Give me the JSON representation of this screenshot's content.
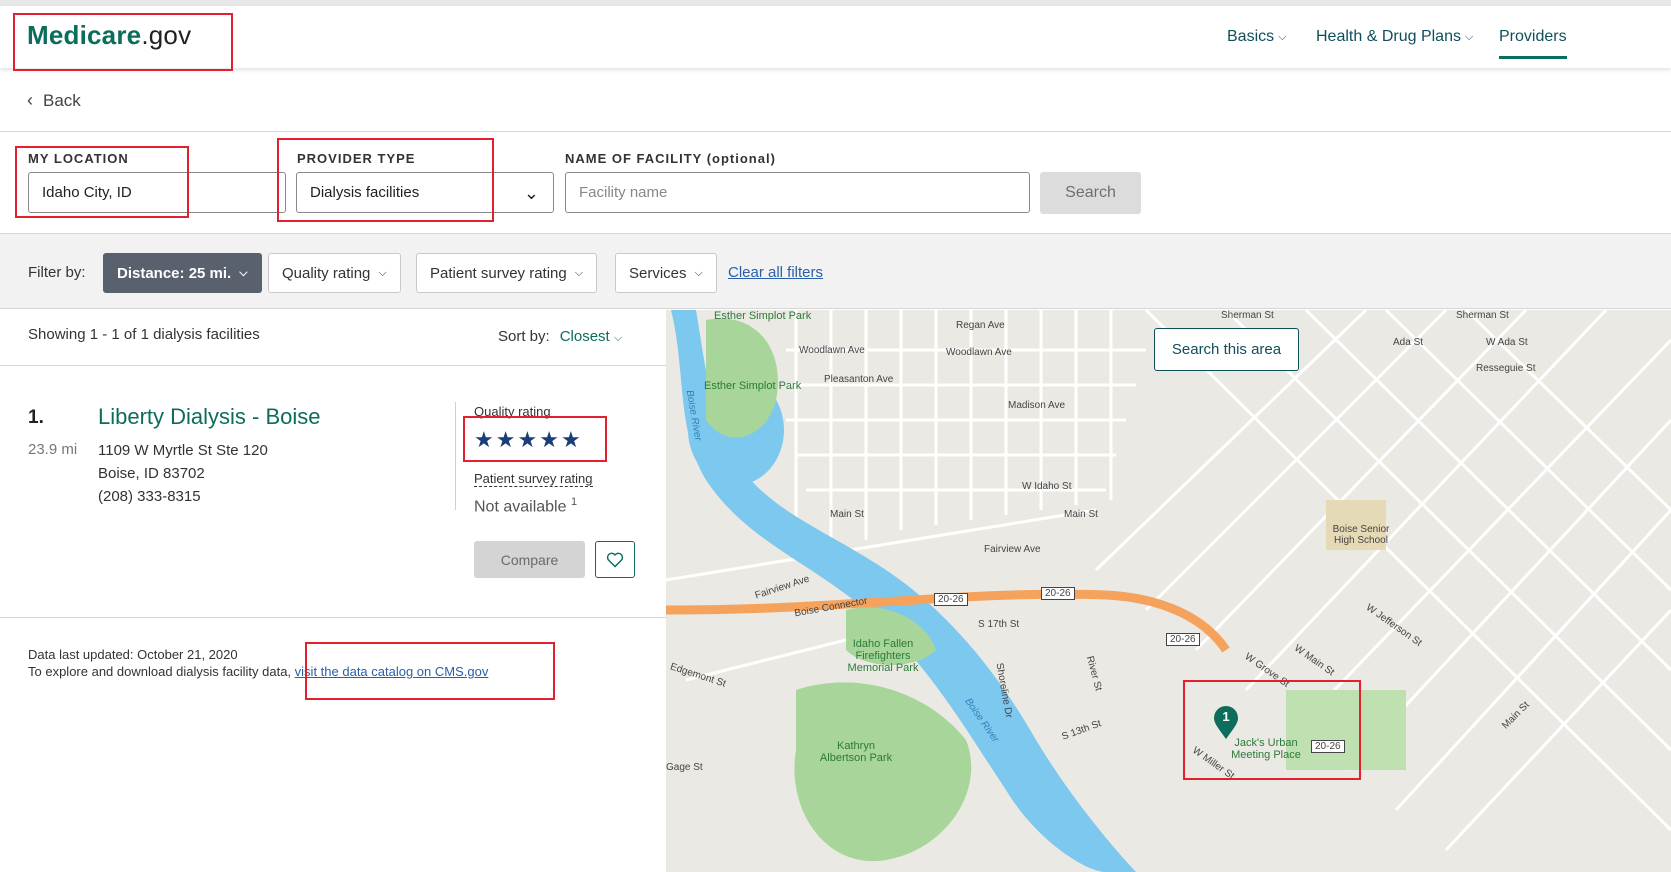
{
  "header": {
    "logo_main": "Medicare",
    "logo_suffix": ".gov",
    "nav": [
      {
        "label": "Basics"
      },
      {
        "label": "Health & Drug Plans"
      },
      {
        "label": "Providers"
      }
    ]
  },
  "back_label": "Back",
  "search": {
    "location_label": "MY LOCATION",
    "location_value": "Idaho City, ID",
    "provider_type_label": "PROVIDER TYPE",
    "provider_type_value": "Dialysis facilities",
    "facility_label": "NAME OF FACILITY (optional)",
    "facility_placeholder": "Facility name",
    "search_button": "Search"
  },
  "filters": {
    "label": "Filter by:",
    "distance": "Distance: 25 mi.",
    "quality": "Quality rating",
    "patient_survey": "Patient survey rating",
    "services": "Services",
    "clear": "Clear all filters"
  },
  "results": {
    "showing": "Showing 1 - 1 of 1 dialysis facilities",
    "sort_label": "Sort by:",
    "sort_value": "Closest",
    "items": [
      {
        "index": "1.",
        "distance": "23.9 mi",
        "name": "Liberty Dialysis - Boise",
        "address1": "1109 W Myrtle St Ste 120",
        "address2": "Boise, ID 83702",
        "phone": "(208) 333-8315",
        "quality_label": "Quality rating",
        "quality_stars": 5,
        "patient_survey_label": "Patient survey rating",
        "patient_survey_value": "Not available",
        "footnote_mark": "1",
        "compare_label": "Compare"
      }
    ]
  },
  "footer": {
    "updated": "Data last updated: October 21, 2020",
    "explore_text": "To explore and download dialysis facility data,",
    "catalog_link": "visit the data catalog on CMS.gov"
  },
  "map": {
    "search_area_button": "Search this area",
    "marker_label": "1",
    "labels": {
      "esther_top": "Esther Simplot Park",
      "esther": "Esther Simplot Park",
      "regan": "Regan Ave",
      "woodlawn1": "Woodlawn Ave",
      "woodlawn2": "Woodlawn Ave",
      "pleasanton": "Pleasanton Ave",
      "madison": "Madison Ave",
      "sherman1": "Sherman St",
      "sherman2": "Sherman St",
      "ada": "Ada St",
      "wada": "W Ada St",
      "resseguie": "Resseguie St",
      "boise_river1": "Boise River",
      "boise_river2": "Boise River",
      "main1": "Main St",
      "main2": "Main St",
      "main3": "Main St",
      "widaho": "W Idaho St",
      "fairview1": "Fairview Ave",
      "fairview2": "Fairview Ave",
      "connector": "Boise Connector",
      "hw1": "20-26",
      "hw2": "20-26",
      "hw3": "20-26",
      "hw4": "20-26",
      "fallen": "Idaho Fallen Firefighters Memorial Park",
      "kathryn": "Kathryn Albertson Park",
      "jacks": "Jack's Urban Meeting Place",
      "boise_senior": "Boise Senior High School",
      "edgemont": "Edgemont St",
      "gage": "Gage St",
      "s13": "S 13th St",
      "s17": "S 17th St",
      "river_st": "River St",
      "shoreline": "Shoreline Dr",
      "wmiller": "W Miller St",
      "wgrove": "W Grove St",
      "wmain": "W Main St",
      "wjefferson": "W Jefferson St"
    }
  }
}
